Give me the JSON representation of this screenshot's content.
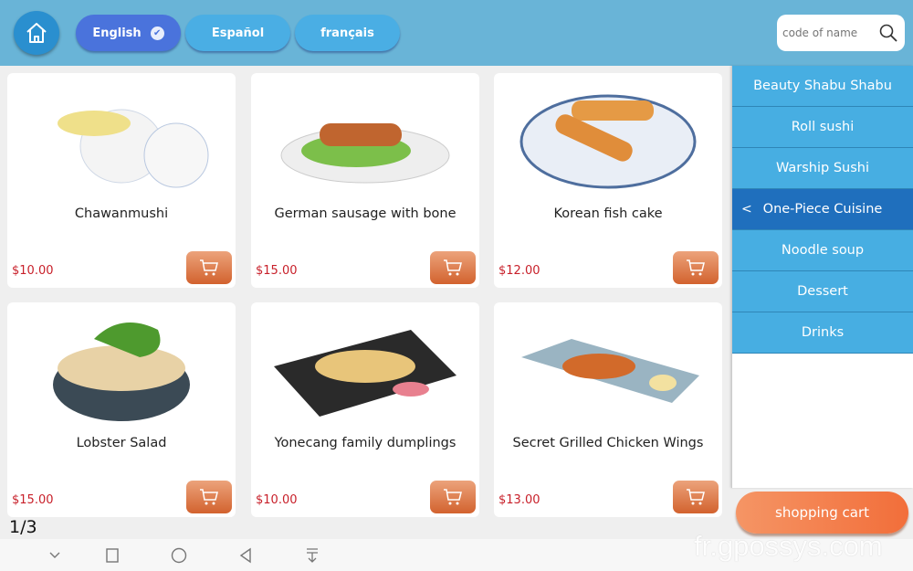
{
  "header": {
    "home_icon": "home-icon",
    "languages": [
      {
        "label": "English",
        "selected": true
      },
      {
        "label": "Español",
        "selected": false
      },
      {
        "label": "français",
        "selected": false
      }
    ],
    "search": {
      "placeholder": "code of name",
      "value": ""
    },
    "accent": "#69b4d7"
  },
  "products": [
    {
      "name": "Chawanmushi",
      "price": "$10.00"
    },
    {
      "name": "German sausage with bone",
      "price": "$15.00"
    },
    {
      "name": "Korean fish cake",
      "price": "$12.00"
    },
    {
      "name": "Lobster Salad",
      "price": "$15.00"
    },
    {
      "name": "Yonecang family dumplings",
      "price": "$10.00"
    },
    {
      "name": "Secret Grilled Chicken Wings",
      "price": "$13.00"
    }
  ],
  "categories": [
    {
      "label": "Beauty Shabu Shabu",
      "active": false
    },
    {
      "label": "Roll sushi",
      "active": false
    },
    {
      "label": "Warship Sushi",
      "active": false
    },
    {
      "label": "One-Piece Cuisine",
      "active": true
    },
    {
      "label": "Noodle soup",
      "active": false
    },
    {
      "label": "Dessert",
      "active": false
    },
    {
      "label": "Drinks",
      "active": false
    }
  ],
  "cart": {
    "label": "shopping cart"
  },
  "pagination": {
    "label": "1/3"
  },
  "watermark": "fr.gpossys.com"
}
